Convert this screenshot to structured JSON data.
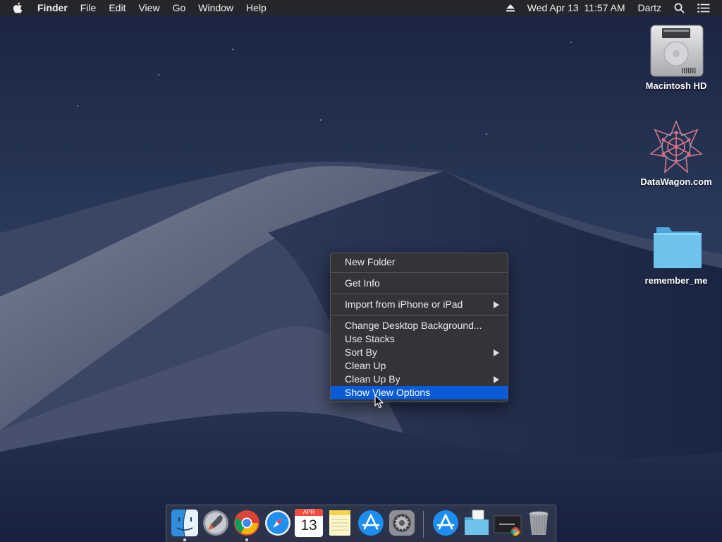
{
  "menubar": {
    "app_name": "Finder",
    "menus": [
      "File",
      "Edit",
      "View",
      "Go",
      "Window",
      "Help"
    ],
    "datetime": "Wed Apr 13  11:57 AM",
    "user": "Dartz",
    "icons": [
      "apple-icon",
      "eject-icon",
      "search-icon",
      "notification-center-icon"
    ]
  },
  "desktop_icons": [
    {
      "label": "Macintosh HD",
      "icon": "hard-drive-icon"
    },
    {
      "label": "DataWagon.com",
      "icon": "network-volume-icon"
    },
    {
      "label": "remember_me",
      "icon": "folder-icon"
    }
  ],
  "context_menu": {
    "items": [
      {
        "label": "New Folder"
      },
      {
        "label": "Get Info"
      },
      {
        "label": "Import from iPhone or iPad",
        "submenu": true
      },
      {
        "label": "Change Desktop Background..."
      },
      {
        "label": "Use Stacks"
      },
      {
        "label": "Sort By",
        "submenu": true
      },
      {
        "label": "Clean Up"
      },
      {
        "label": "Clean Up By",
        "submenu": true
      },
      {
        "label": "Show View Options",
        "highlighted": true
      }
    ]
  },
  "dock": {
    "calendar_month": "APR",
    "calendar_day": "13",
    "apps": [
      "finder-icon",
      "launchpad-icon",
      "chrome-icon",
      "safari-icon",
      "calendar-icon",
      "notes-icon",
      "app-store-icon",
      "system-preferences-icon",
      "app-store-download-icon",
      "documents-folder-icon",
      "chrome-minimized-window-icon",
      "trash-icon"
    ],
    "running": [
      "Finder",
      "Chrome"
    ]
  },
  "colors": {
    "menubar_bg": "#24262b",
    "menu_bg": "#343438",
    "highlight": "#0a5bd8",
    "wallpaper": "#1b2744"
  }
}
